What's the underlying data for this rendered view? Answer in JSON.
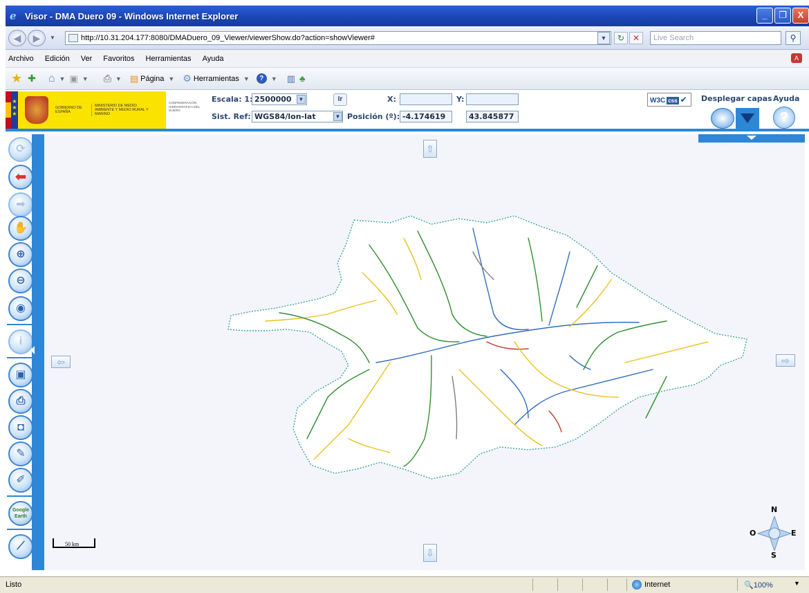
{
  "window": {
    "title": "Visor - DMA Duero 09 - Windows Internet Explorer",
    "minimize": "_",
    "restore": "❐",
    "close": "X"
  },
  "address_bar": {
    "url": "http://10.31.204.177:8080/DMADuero_09_Viewer/viewerShow.do?action=showViewer#",
    "search_placeholder": "Live Search"
  },
  "menu": {
    "items": [
      "Archivo",
      "Edición",
      "Ver",
      "Favoritos",
      "Herramientas",
      "Ayuda"
    ]
  },
  "command_bar": {
    "page_label": "Página",
    "tools_label": "Herramientas"
  },
  "header": {
    "logo_gov": "GOBIERNO DE ESPAÑA",
    "logo_ministry": "MINISTERIO DE MEDIO AMBIENTE Y MEDIO RURAL Y MARINO",
    "logo_conf": "CONFEDERACIÓN HIDROGRÁFICA DEL DUERO",
    "scale_label": "Escala: 1:",
    "scale_value": "2500000",
    "go_button": "Ir",
    "x_label": "X:",
    "x_value": "",
    "y_label": "Y:",
    "y_value": "",
    "ref_label": "Sist. Ref:",
    "ref_value": "WGS84/lon-lat",
    "position_label": "Posición (º):",
    "position_lon": "-4.174619",
    "position_lat": "43.845877",
    "w3c_label": "W3C",
    "css_label": "css",
    "layers_label": "Desplegar capas",
    "help_label": "Ayuda"
  },
  "toolbar": {
    "earth_label": "Google Earth"
  },
  "map": {
    "scale_label": "50 km",
    "compass": {
      "n": "N",
      "s": "S",
      "e": "E",
      "w": "O"
    },
    "river_colors": [
      "#2f8f2f",
      "#e8c21c",
      "#2f6cc0",
      "#7d7d7d",
      "#c0392b"
    ]
  },
  "status_bar": {
    "status": "Listo",
    "zone": "Internet",
    "zoom": "100%"
  }
}
